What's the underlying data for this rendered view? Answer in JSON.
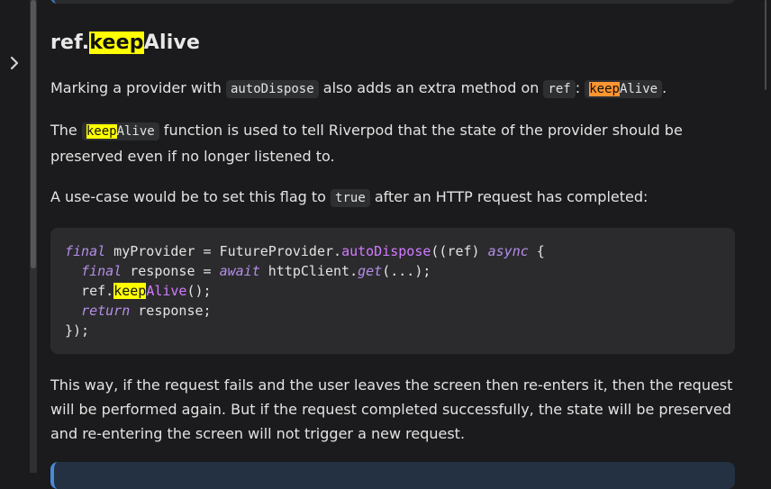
{
  "heading": {
    "prefix": "ref.",
    "highlight": "keep",
    "suffix": "Alive"
  },
  "p1": {
    "t1": "Marking a provider with ",
    "c1": "autoDispose",
    "t2": " also adds an extra method on ",
    "c2": "ref",
    "t3": ": ",
    "c3_hl": "keep",
    "c3_rest": "Alive",
    "t4": "."
  },
  "p2": {
    "t1": "The ",
    "c1_hl": "keep",
    "c1_rest": "Alive",
    "t2": " function is used to tell Riverpod that the state of the provider should be preserved even if no longer listened to."
  },
  "p3": {
    "t1": "A use-case would be to set this flag to ",
    "c1": "true",
    "t2": " after an HTTP request has completed:"
  },
  "code": {
    "l1_kw": "final",
    "l1_a": " myProvider = FutureProvider.",
    "l1_fn": "autoDispose",
    "l1_b": "((ref) ",
    "l1_async": "async",
    "l1_c": " {",
    "l2_kw": "final",
    "l2_a": " response = ",
    "l2_await": "await",
    "l2_b": " httpClient.",
    "l2_get": "get",
    "l2_c": "(...);",
    "l3_a": "ref.",
    "l3_hl": "keep",
    "l3_rest": "Alive",
    "l3_b": "();",
    "l4_kw": "return",
    "l4_a": " response;",
    "l5": "});"
  },
  "p4": "This way, if the request fails and the user leaves the screen then re-enters it, then the request will be performed again. But if the request completed successfully, the state will be preserved and re-entering the screen will not trigger a new request.",
  "icons": {
    "expand": "chevron-right-icon"
  }
}
